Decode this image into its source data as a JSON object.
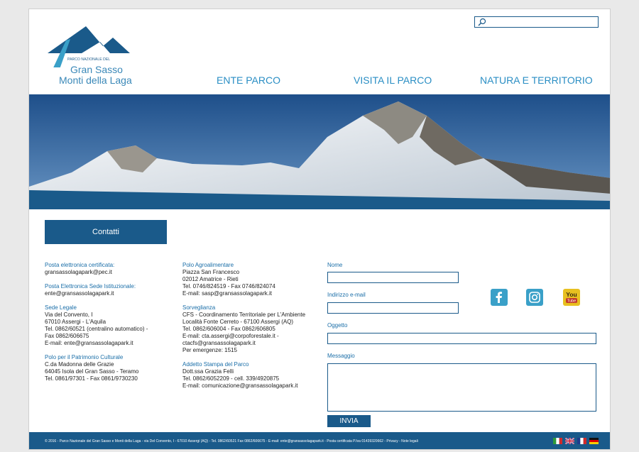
{
  "search": {
    "placeholder": ""
  },
  "logo": {
    "line1": "PARCO NAZIONALE DEL",
    "line2": "Gran Sasso",
    "line3": "Monti della Laga"
  },
  "nav": {
    "items": [
      {
        "label": "ENTE PARCO"
      },
      {
        "label": "VISITA IL PARCO"
      },
      {
        "label": "NATURA E TERRITORIO"
      }
    ]
  },
  "contacts": {
    "title": "Contatti",
    "col1": [
      {
        "heading": "Posta elettronica certificata:",
        "lines": [
          "gransassolagapark@pec.it"
        ]
      },
      {
        "heading": "Posta Elettronica Sede Istituzionale:",
        "lines": [
          "ente@gransassolagapark.it"
        ]
      },
      {
        "heading": "Sede Legale",
        "lines": [
          "Via del Convento, I",
          "67010 Assergi - L'Aquila",
          "Tel. 0862/60521 (centralino automatico) -",
          "Fax 0862/606675",
          "E-mail: ente@gransassolagapark.it"
        ]
      },
      {
        "heading": "Polo per il Patrimonio Culturale",
        "lines": [
          "C.da Madonna delle Grazie",
          "64045 Isola del Gran Sasso - Teramo",
          "Tel. 0861/97301 - Fax 0861/9730230"
        ]
      }
    ],
    "col2": [
      {
        "heading": "Polo Agroalimentare",
        "lines": [
          "Piazza San Francesco",
          "02012 Amatrice - Rieti",
          "Tel. 0746/824519 - Fax 0746/824074",
          "E-mail: sasp@gransassolagapark.it"
        ]
      },
      {
        "heading": "Sorveglianza",
        "lines": [
          "CFS - Coordinamento Territoriale per L'Ambiente",
          "Località Fonte Cerreto - 67100 Assergi (AQ)",
          "Tel. 0862/606004 - Fax 0862/606805",
          "E-mail: cta.assergi@corpoforestale.it -",
          "ctacfs@gransassolagapark.it",
          "Per emergenze: 1515"
        ]
      },
      {
        "heading": "Addetto Stampa del Parco",
        "lines": [
          "Dott.ssa Grazia Felli",
          "Tel. 0862/6052209 - cell. 339/4920875",
          "E-mail: comunicazione@gransassolagapark.it"
        ]
      }
    ]
  },
  "form": {
    "name_label": "Nome",
    "email_label": "Indirizzo e-mail",
    "subject_label": "Oggetto",
    "message_label": "Messaggio",
    "submit_label": "INVIA"
  },
  "social": {
    "facebook_icon": "facebook-icon",
    "instagram_icon": "instagram-icon",
    "youtube_icon": "youtube-icon",
    "youtube_text_1": "You",
    "youtube_text_2": "Tube"
  },
  "footer": {
    "text": "© 2016 - Parco Nazionale del Gran Sasso e Monti della Laga - via Del Convento, I - 67010 Assergi (AQ) - Tel. 0862/60521 Fax 0862/606675 - E-mail: ente@gransassolagapark.it - Posta certificata P.Iva 01439320662 - Privacy - Note legali"
  },
  "colors": {
    "brand_blue": "#1a5a8a",
    "nav_blue": "#2a8ec4",
    "social_blue": "#3aa0c8",
    "youtube_yellow": "#e8c020"
  }
}
